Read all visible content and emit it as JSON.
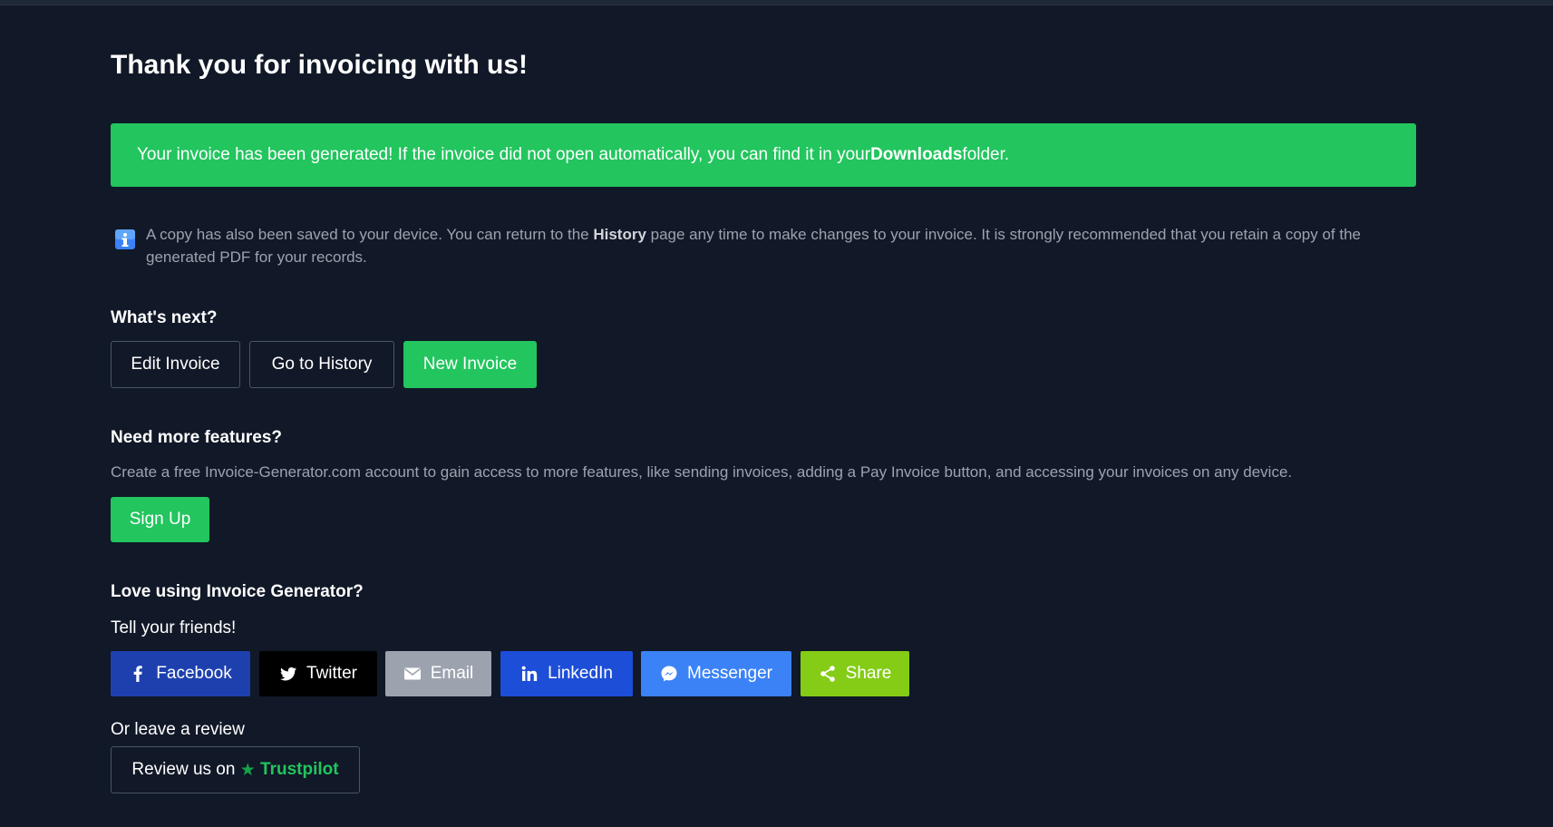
{
  "header": {
    "title": "Thank you for invoicing with us!"
  },
  "alert": {
    "text_before": "Your invoice has been generated! If the invoice did not open automatically, you can find it in your ",
    "bold": "Downloads",
    "text_after": " folder."
  },
  "info": {
    "icon": "info-icon",
    "text_before": "A copy has also been saved to your device. You can return to the ",
    "bold": "History",
    "text_after": " page any time to make changes to your invoice. It is strongly recommended that you retain a copy of the generated PDF for your records."
  },
  "next": {
    "heading": "What's next?",
    "edit_label": "Edit Invoice",
    "history_label": "Go to History",
    "new_label": "New Invoice"
  },
  "features": {
    "heading": "Need more features?",
    "description": "Create a free Invoice-Generator.com account to gain access to more features, like sending invoices, adding a Pay Invoice button, and accessing your invoices on any device.",
    "signup_label": "Sign Up"
  },
  "love": {
    "heading": "Love using Invoice Generator?",
    "subheading": "Tell your friends!",
    "share_buttons": [
      {
        "label": "Facebook",
        "icon": "facebook-icon",
        "color": "#1e40af"
      },
      {
        "label": "Twitter",
        "icon": "twitter-icon",
        "color": "#000000"
      },
      {
        "label": "Email",
        "icon": "email-icon",
        "color": "#9ca3af"
      },
      {
        "label": "LinkedIn",
        "icon": "linkedin-icon",
        "color": "#1d4ed8"
      },
      {
        "label": "Messenger",
        "icon": "messenger-icon",
        "color": "#3b82f6"
      },
      {
        "label": "Share",
        "icon": "share-icon",
        "color": "#84cc16"
      }
    ]
  },
  "review": {
    "prompt": "Or leave a review",
    "button_prefix": "Review us on ",
    "star": "★",
    "brand": "Trustpilot"
  },
  "colors": {
    "background": "#111827",
    "accent_green": "#22c55e",
    "muted_text": "#9ca3af"
  }
}
